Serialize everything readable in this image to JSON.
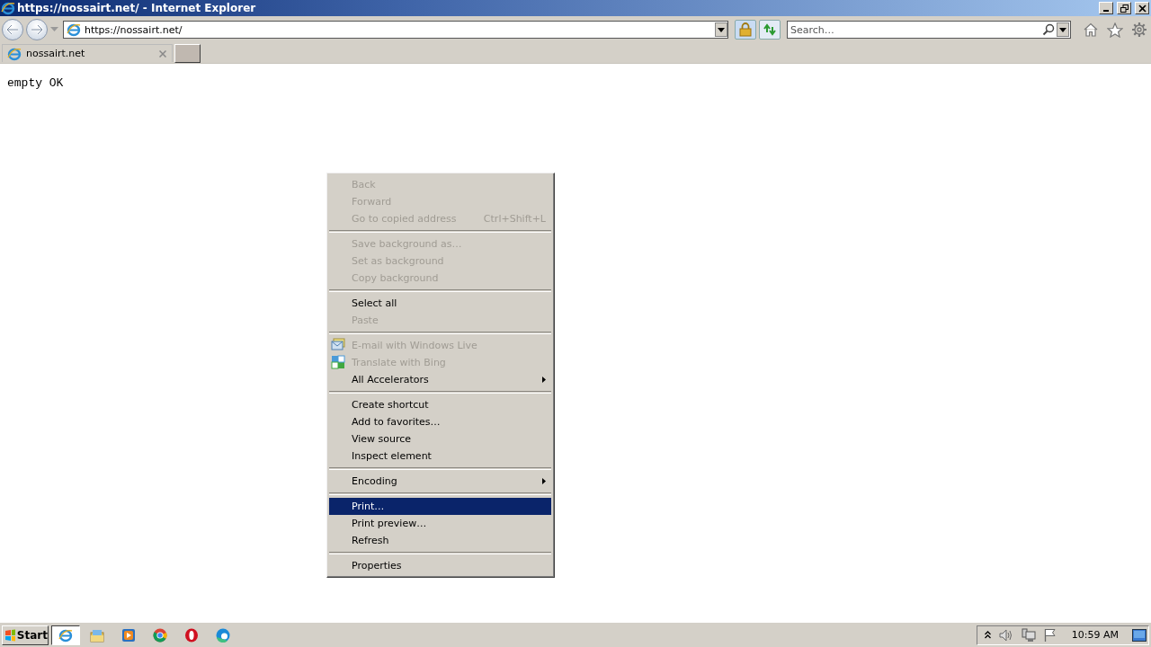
{
  "window": {
    "title": "https://nossairt.net/ - Internet Explorer"
  },
  "address_bar": {
    "value": "https://nossairt.net/"
  },
  "search": {
    "placeholder": "Search…"
  },
  "tabs": [
    {
      "label": "nossairt.net",
      "selected": true
    }
  ],
  "page": {
    "text": "empty OK"
  },
  "context_menu": {
    "groups": [
      {
        "items": [
          {
            "kind": "item",
            "label": "Back",
            "disabled": true,
            "selected": false
          },
          {
            "kind": "item",
            "label": "Forward",
            "disabled": true,
            "selected": false
          },
          {
            "kind": "item",
            "label": "Go to copied address",
            "shortcut": "Ctrl+Shift+L",
            "disabled": true,
            "selected": false
          }
        ]
      },
      {
        "items": [
          {
            "kind": "item",
            "label": "Save background as…",
            "disabled": true,
            "selected": false
          },
          {
            "kind": "item",
            "label": "Set as background",
            "disabled": true,
            "selected": false
          },
          {
            "kind": "item",
            "label": "Copy background",
            "disabled": true,
            "selected": false
          }
        ]
      },
      {
        "items": [
          {
            "kind": "item",
            "label": "Select all",
            "disabled": false,
            "selected": false
          },
          {
            "kind": "item",
            "label": "Paste",
            "disabled": true,
            "selected": false
          }
        ]
      },
      {
        "items": [
          {
            "kind": "accelerator",
            "label": "E-mail with Windows Live",
            "disabled": true,
            "selected": false
          },
          {
            "kind": "accelerator",
            "label": "Translate with Bing",
            "disabled": true,
            "selected": false
          },
          {
            "kind": "submenu",
            "label": "All Accelerators",
            "disabled": false,
            "selected": false
          }
        ]
      },
      {
        "items": [
          {
            "kind": "item",
            "label": "Create shortcut",
            "disabled": false,
            "selected": false
          },
          {
            "kind": "item",
            "label": "Add to favorites…",
            "disabled": false,
            "selected": false
          },
          {
            "kind": "item",
            "label": "View source",
            "disabled": false,
            "selected": false
          },
          {
            "kind": "item",
            "label": "Inspect element",
            "disabled": false,
            "selected": false
          }
        ]
      },
      {
        "items": [
          {
            "kind": "submenu",
            "label": "Encoding",
            "disabled": false,
            "selected": false
          }
        ]
      },
      {
        "items": [
          {
            "kind": "item",
            "label": "Print…",
            "disabled": false,
            "selected": true
          },
          {
            "kind": "item",
            "label": "Print preview…",
            "disabled": false,
            "selected": false
          },
          {
            "kind": "item",
            "label": "Refresh",
            "disabled": false,
            "selected": false
          }
        ]
      },
      {
        "items": [
          {
            "kind": "item",
            "label": "Properties",
            "disabled": false,
            "selected": false
          }
        ]
      }
    ]
  },
  "taskbar": {
    "start_label": "Start",
    "apps": [
      {
        "kind": "ie",
        "selected": true
      },
      {
        "kind": "explorer",
        "selected": false
      },
      {
        "kind": "media",
        "selected": false
      },
      {
        "kind": "chrome",
        "selected": false
      },
      {
        "kind": "opera",
        "selected": false
      },
      {
        "kind": "edge",
        "selected": false
      }
    ],
    "clock": "10:59 AM"
  }
}
